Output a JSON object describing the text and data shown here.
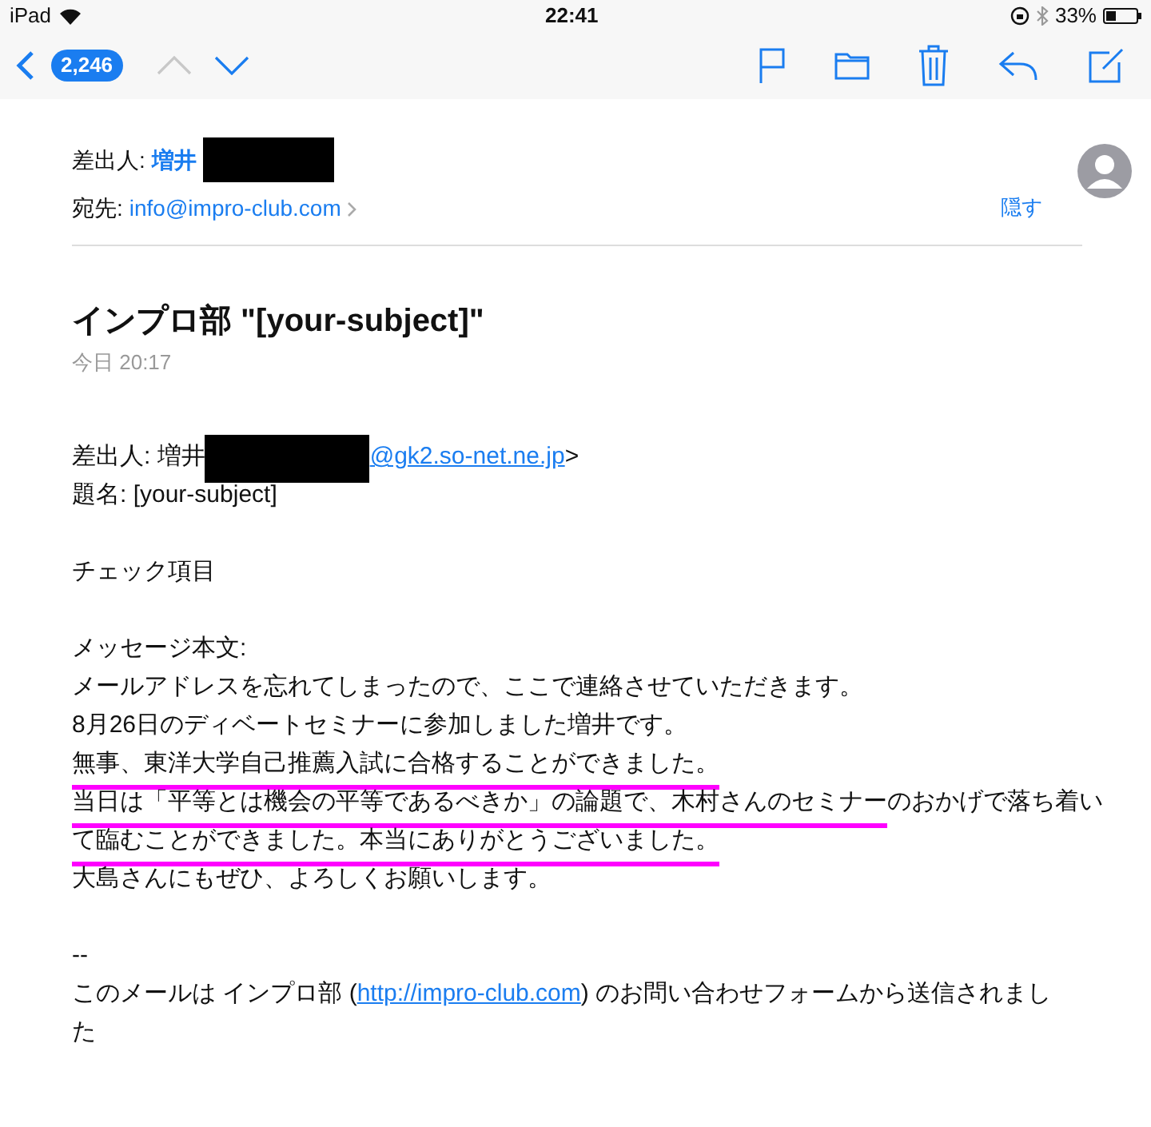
{
  "status_bar": {
    "device": "iPad",
    "time": "22:41",
    "battery": "33%"
  },
  "toolbar": {
    "back_count": "2,246",
    "previous_enabled": false,
    "next_enabled": true
  },
  "header": {
    "from_label": "差出人:",
    "from_name": "増井",
    "from_redacted": true,
    "to_label": "宛先:",
    "to_address": "info@impro-club.com",
    "hide_link": "隠す"
  },
  "subject": "インプロ部 \"[your-subject]\"",
  "date": "今日 20:17",
  "body": [
    {
      "lines": [
        {
          "segments": [
            {
              "kind": "text",
              "text": "差出人: 増井",
              "underlined": false
            },
            {
              "kind": "redacted"
            },
            {
              "kind": "link",
              "text": "@gk2.so-net.ne.jp",
              "underlined": false
            },
            {
              "kind": "text",
              "text": ">",
              "underlined": false
            }
          ]
        },
        {
          "segments": [
            {
              "kind": "text",
              "text": "題名: [your-subject]",
              "underlined": false
            }
          ]
        }
      ]
    },
    {
      "lines": [
        {
          "segments": [
            {
              "kind": "text",
              "text": "チェック項目",
              "underlined": false
            }
          ]
        }
      ]
    },
    {
      "lines": [
        {
          "segments": [
            {
              "kind": "text",
              "text": "メッセージ本文:",
              "underlined": false
            }
          ]
        },
        {
          "segments": [
            {
              "kind": "text",
              "text": "メールアドレスを忘れてしまったので、ここで連絡させていただきます。",
              "underlined": false
            }
          ]
        },
        {
          "segments": [
            {
              "kind": "text",
              "text": "8月26日のディベートセミナーに参加しました増井です。",
              "underlined": false
            }
          ]
        },
        {
          "segments": [
            {
              "kind": "text",
              "text": "無事、東洋大学自己推薦入試に合格することができました。",
              "underlined": true
            }
          ]
        },
        {
          "segments": [
            {
              "kind": "text",
              "text": "当日は「平等とは機会の平等であるべきか」の論題で、木村さんのセミナー",
              "underlined": true
            },
            {
              "kind": "text",
              "text": "のおかげで落ち着い",
              "underlined": false
            }
          ]
        },
        {
          "segments": [
            {
              "kind": "text",
              "text": "て臨むことができました。本当にありがとうございました。",
              "underlined": true
            }
          ]
        },
        {
          "segments": [
            {
              "kind": "text",
              "text": "大島さんにもぜひ、よろしくお願いします。",
              "underlined": false
            }
          ]
        }
      ]
    },
    {
      "lines": [
        {
          "segments": [
            {
              "kind": "text",
              "text": "--",
              "underlined": false
            }
          ]
        },
        {
          "segments": [
            {
              "kind": "text",
              "text": "このメールは インプロ部 (",
              "underlined": false
            },
            {
              "kind": "link",
              "text": "http://impro-club.com",
              "underlined": false
            },
            {
              "kind": "text",
              "text": ") のお問い合わせフォームから送信されまし",
              "underlined": false
            }
          ]
        },
        {
          "segments": [
            {
              "kind": "text",
              "text": "た",
              "underlined": false
            }
          ]
        }
      ]
    }
  ]
}
